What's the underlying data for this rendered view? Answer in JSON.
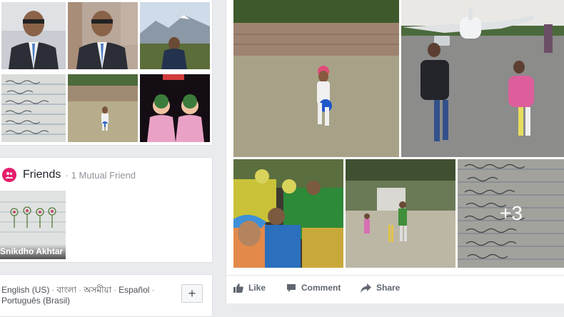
{
  "friends": {
    "title": "Friends",
    "separator": "·",
    "mutual": "1 Mutual Friend",
    "items": [
      {
        "name": "Snikdho Akhtar"
      }
    ]
  },
  "languages": {
    "line1": [
      "English (US)",
      "বাংলা",
      "অসমীয়া",
      "Español"
    ],
    "line2": "Português (Brasil)",
    "separator": "·",
    "add_label": "+"
  },
  "post": {
    "more_count": "+3",
    "actions": {
      "like": "Like",
      "comment": "Comment",
      "share": "Share"
    }
  },
  "icons": {
    "friends": "people-icon",
    "like": "thumbs-up-icon",
    "comment": "comment-bubble-icon",
    "share": "share-arrow-icon"
  },
  "colors": {
    "friends_badge": "#e41e6b",
    "action_text": "#606770"
  }
}
